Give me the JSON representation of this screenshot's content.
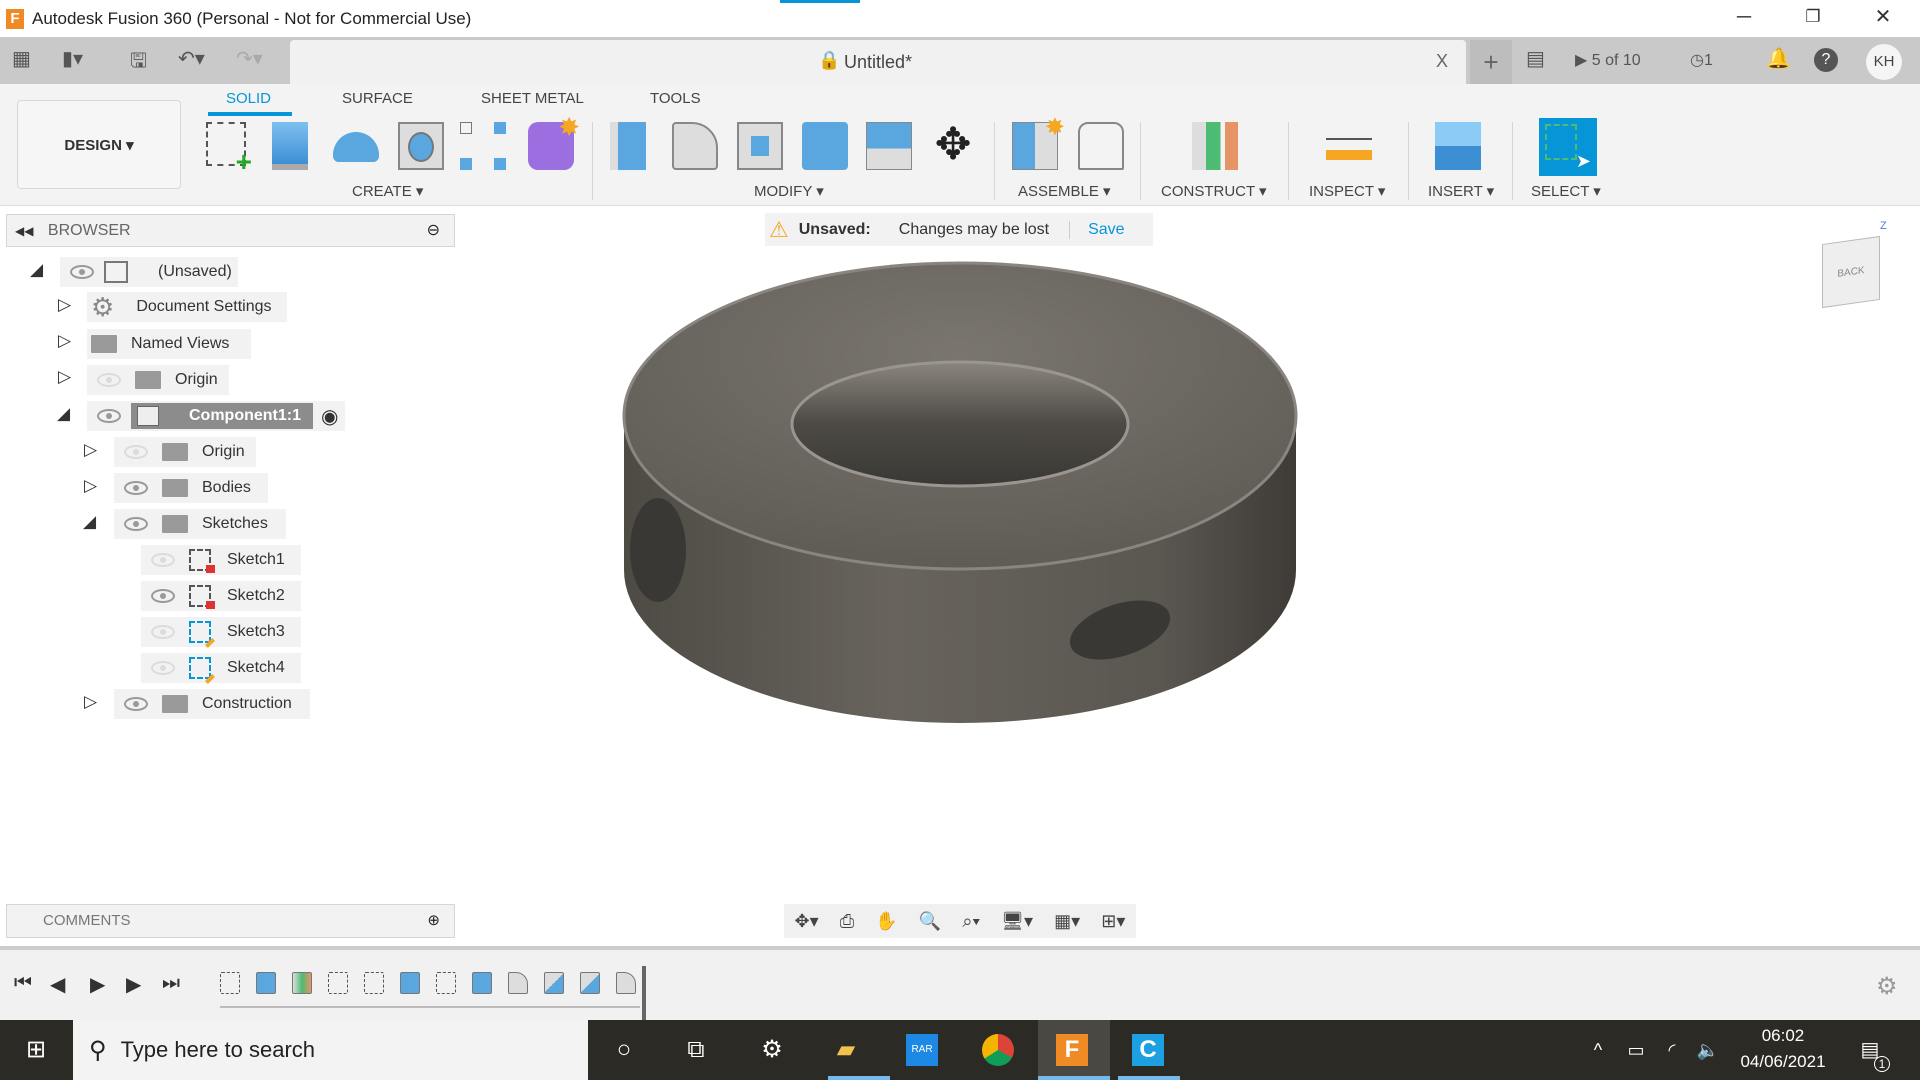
{
  "window": {
    "title": "Autodesk Fusion 360 (Personal - Not for Commercial Use)",
    "logo": "F",
    "minimize": "─",
    "restore": "❐",
    "close": "✕"
  },
  "doc_tab": {
    "title": "Untitled*",
    "close": "X",
    "new_tab": "+"
  },
  "header_right": {
    "jobs": "5 of 10",
    "clock_count": "1",
    "user": "KH"
  },
  "design_button": "DESIGN ▾",
  "ribbon_tabs": [
    {
      "label": "SOLID"
    },
    {
      "label": "SURFACE"
    },
    {
      "label": "SHEET METAL"
    },
    {
      "label": "TOOLS"
    }
  ],
  "groups": {
    "create": "CREATE ▾",
    "modify": "MODIFY ▾",
    "assemble": "ASSEMBLE ▾",
    "construct": "CONSTRUCT ▾",
    "inspect": "INSPECT ▾",
    "insert": "INSERT ▾",
    "select": "SELECT ▾"
  },
  "browser": {
    "title": "BROWSER",
    "items": [
      {
        "label": "(Unsaved)"
      },
      {
        "label": "Document Settings"
      },
      {
        "label": "Named Views"
      },
      {
        "label": "Origin"
      },
      {
        "label": "Component1:1"
      },
      {
        "label": "Origin"
      },
      {
        "label": "Bodies"
      },
      {
        "label": "Sketches"
      },
      {
        "label": "Sketch1"
      },
      {
        "label": "Sketch2"
      },
      {
        "label": "Sketch3"
      },
      {
        "label": "Sketch4"
      },
      {
        "label": "Construction"
      }
    ]
  },
  "unsaved_bar": {
    "label": "Unsaved:",
    "message": "Changes may be lost",
    "save": "Save"
  },
  "viewcube": {
    "face": "BACK",
    "axis": "Z"
  },
  "comments": {
    "title": "COMMENTS"
  },
  "taskbar": {
    "search_placeholder": "Type here to search",
    "time": "06:02",
    "date": "04/06/2021",
    "notifications": "1"
  },
  "colors": {
    "accent": "#0696d7",
    "select_blue": "#0696d7",
    "taskbar": "#2b2a24"
  }
}
